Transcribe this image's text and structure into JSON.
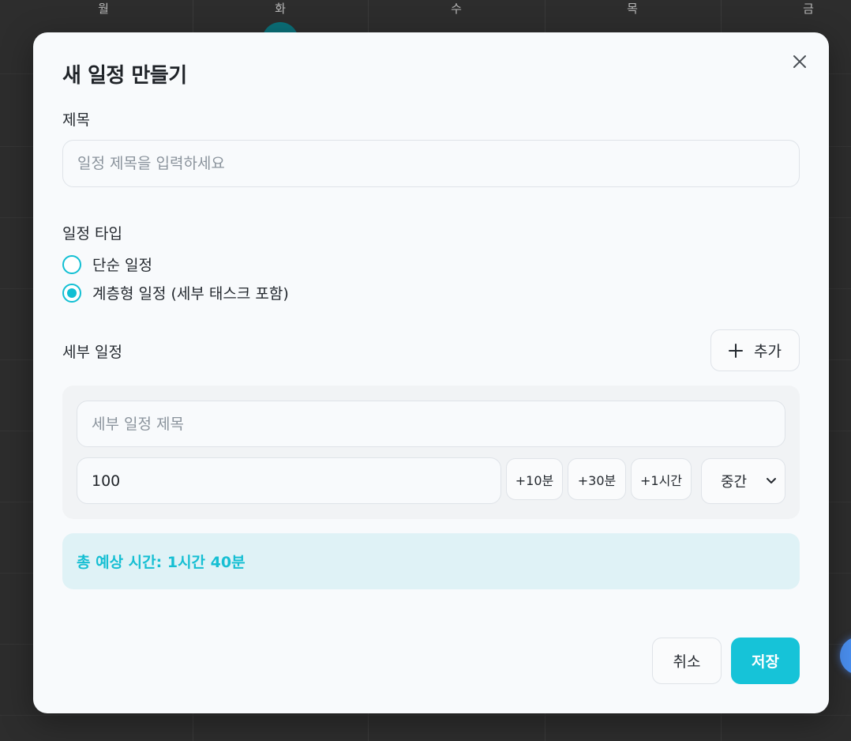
{
  "calendar": {
    "days": [
      "월",
      "화",
      "수",
      "목",
      "금"
    ]
  },
  "modal": {
    "title": "새 일정 만들기",
    "title_field": {
      "label": "제목",
      "placeholder": "일정 제목을 입력하세요",
      "value": ""
    },
    "schedule_type": {
      "label": "일정 타입",
      "options": [
        {
          "label": "단순 일정",
          "selected": false
        },
        {
          "label": "계층형 일정 (세부 태스크 포함)",
          "selected": true
        }
      ]
    },
    "subtasks": {
      "label": "세부 일정",
      "add_label": "추가",
      "items": [
        {
          "title_placeholder": "세부 일정 제목",
          "title_value": "",
          "duration_value": "100",
          "quick_buttons": [
            "+10분",
            "+30분",
            "+1시간"
          ],
          "priority": "중간"
        }
      ]
    },
    "total_time": "총 예상 시간: 1시간 40분",
    "cancel_label": "취소",
    "save_label": "저장"
  },
  "colors": {
    "accent": "#16c3d8",
    "total_bg": "#dff2f6"
  }
}
